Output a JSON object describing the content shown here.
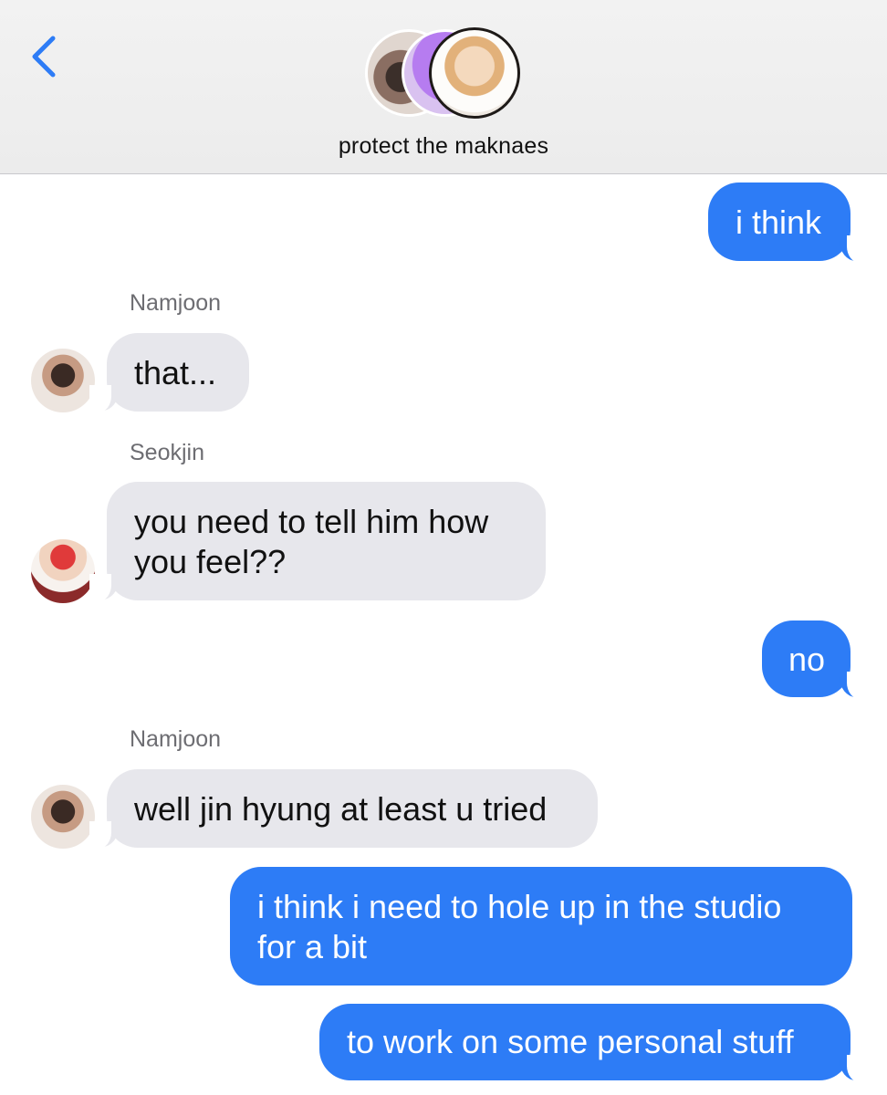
{
  "header": {
    "back_label": "<",
    "group_name": "protect the maknaes"
  },
  "messages": [
    {
      "type": "outgoing",
      "text": "i think"
    },
    {
      "type": "incoming",
      "sender": "Namjoon",
      "text": "that..."
    },
    {
      "type": "incoming",
      "sender": "Seokjin",
      "text": "you need to tell him how you feel??"
    },
    {
      "type": "outgoing",
      "text": "no"
    },
    {
      "type": "incoming",
      "sender": "Namjoon",
      "text": "well jin hyung at least u tried"
    },
    {
      "type": "outgoing",
      "text": "i think i need to hole up in the studio for a bit"
    },
    {
      "type": "outgoing",
      "text": "to work on some personal stuff"
    }
  ],
  "colors": {
    "outgoing_bubble": "#2d7cf6",
    "incoming_bubble": "#e7e7ec",
    "accent": "#2d7cf6"
  }
}
